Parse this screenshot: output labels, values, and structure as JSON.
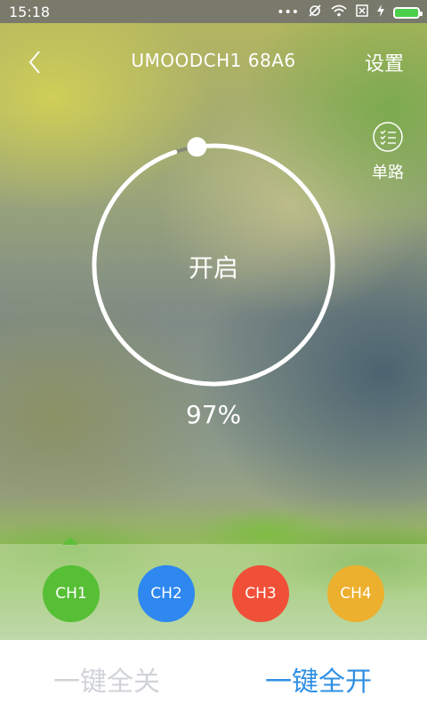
{
  "status_bar": {
    "time": "15:18",
    "icons": [
      "more-dots-icon",
      "mute-alarm-icon",
      "wifi-icon",
      "sim-off-icon",
      "charging-icon",
      "battery-icon"
    ]
  },
  "header": {
    "title": "UMOODCH1 68A6",
    "settings_label": "设置"
  },
  "single_mode": {
    "label": "单路"
  },
  "dial": {
    "state_label": "开启",
    "percent_label": "97%",
    "level": 0.97
  },
  "channels": [
    {
      "label": "CH1",
      "color": "#57bf36"
    },
    {
      "label": "CH2",
      "color": "#2e88f0"
    },
    {
      "label": "CH3",
      "color": "#f05038"
    },
    {
      "label": "CH4",
      "color": "#ecb02e"
    }
  ],
  "bottom": {
    "all_off_label": "一键全关",
    "all_on_label": "一键全开"
  },
  "colors": {
    "accent": "#2f8fe3",
    "disabled": "#d0d3d8"
  }
}
